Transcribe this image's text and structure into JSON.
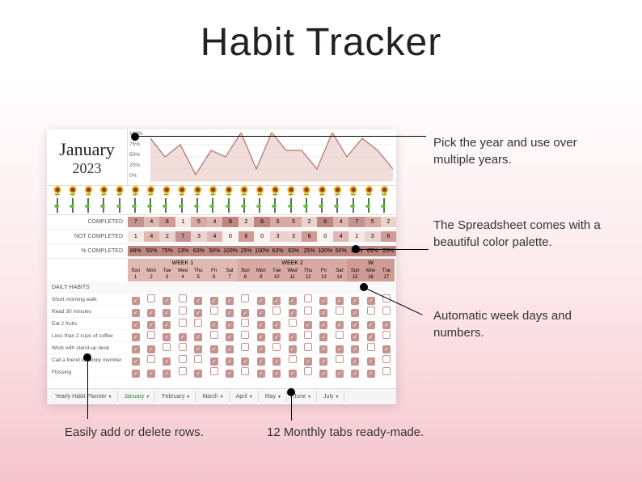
{
  "title": "Habit Tracker",
  "month": "January",
  "year": "2023",
  "chart_data": {
    "type": "area",
    "ylabel": "",
    "xlabel": "",
    "ylim": [
      0,
      100
    ],
    "yticks": [
      "100%",
      "75%",
      "50%",
      "25%",
      "0%"
    ],
    "values": [
      88,
      50,
      75,
      13,
      63,
      50,
      100,
      25,
      100,
      63,
      63,
      25,
      100,
      50,
      88,
      63,
      25
    ]
  },
  "summary": {
    "rows": [
      {
        "label": "COMPLETED",
        "values": [
          "7",
          "4",
          "6",
          "1",
          "5",
          "4",
          "8",
          "2",
          "8",
          "5",
          "5",
          "2",
          "8",
          "4",
          "7",
          "5",
          "2"
        ]
      },
      {
        "label": "NOT COMPLETED",
        "values": [
          "1",
          "4",
          "2",
          "7",
          "3",
          "4",
          "0",
          "6",
          "0",
          "3",
          "3",
          "6",
          "0",
          "4",
          "1",
          "3",
          "6"
        ]
      },
      {
        "label": "% COMPLETED",
        "values": [
          "88%",
          "50%",
          "75%",
          "13%",
          "63%",
          "50%",
          "100%",
          "25%",
          "100%",
          "63%",
          "63%",
          "25%",
          "100%",
          "50%",
          "88%",
          "63%",
          "25%"
        ]
      }
    ]
  },
  "weeks": [
    {
      "title": "WEEK 1",
      "days": [
        "Sun",
        "Mon",
        "Tue",
        "Wed",
        "Thu",
        "Fri",
        "Sat"
      ],
      "nums": [
        "1",
        "2",
        "3",
        "4",
        "5",
        "6",
        "7"
      ]
    },
    {
      "title": "WEEK 2",
      "days": [
        "Sun",
        "Mon",
        "Tue",
        "Wed",
        "Thu",
        "Fri",
        "Sat"
      ],
      "nums": [
        "8",
        "9",
        "10",
        "11",
        "12",
        "13",
        "14"
      ]
    },
    {
      "title": "W",
      "days": [
        "Sun",
        "Mon",
        "Tue"
      ],
      "nums": [
        "15",
        "16",
        "17"
      ]
    }
  ],
  "habits_header": "DAILY HABITS",
  "habits": [
    {
      "name": "Short morning walk",
      "checks": [
        1,
        0,
        1,
        0,
        1,
        1,
        1,
        0,
        1,
        1,
        1,
        0,
        1,
        1,
        1,
        1,
        0
      ]
    },
    {
      "name": "Read 30 minutes",
      "checks": [
        1,
        1,
        1,
        0,
        1,
        0,
        1,
        1,
        1,
        0,
        1,
        0,
        1,
        0,
        1,
        0,
        0
      ]
    },
    {
      "name": "Eat 2 fruits",
      "checks": [
        1,
        1,
        1,
        0,
        0,
        1,
        1,
        0,
        1,
        1,
        0,
        1,
        1,
        1,
        1,
        1,
        1
      ]
    },
    {
      "name": "Less than 2 cups of coffee",
      "checks": [
        1,
        0,
        1,
        1,
        1,
        0,
        1,
        0,
        1,
        1,
        1,
        0,
        1,
        0,
        1,
        1,
        0
      ]
    },
    {
      "name": "Work with stand-up desk",
      "checks": [
        1,
        1,
        0,
        0,
        1,
        1,
        1,
        0,
        1,
        0,
        1,
        0,
        1,
        1,
        1,
        0,
        1
      ]
    },
    {
      "name": "Call a friend or family member",
      "checks": [
        1,
        0,
        1,
        0,
        0,
        1,
        1,
        1,
        1,
        1,
        0,
        1,
        1,
        0,
        1,
        1,
        0
      ]
    },
    {
      "name": "Flossing",
      "checks": [
        1,
        1,
        1,
        0,
        1,
        0,
        1,
        0,
        1,
        1,
        1,
        0,
        1,
        1,
        1,
        1,
        0
      ]
    }
  ],
  "tabs": [
    {
      "label": "Yearly Habit Planner",
      "active": false
    },
    {
      "label": "January",
      "active": true
    },
    {
      "label": "February",
      "active": false
    },
    {
      "label": "March",
      "active": false
    },
    {
      "label": "April",
      "active": false
    },
    {
      "label": "May",
      "active": false
    },
    {
      "label": "June",
      "active": false
    },
    {
      "label": "July",
      "active": false
    }
  ],
  "callouts": {
    "c1": "Pick the year and use over multiple years.",
    "c2": "The Spreadsheet comes with a beautiful color palette.",
    "c3": "Automatic week days and numbers.",
    "c4": "Easily add or delete rows.",
    "c5": "12 Monthly tabs ready-made."
  },
  "colors": {
    "heat": [
      "#e8c8c3",
      "#d9aaa3",
      "#cf9b94",
      "#c4928f",
      "#bd8680",
      "#e8c8c3",
      "#f0ded9"
    ]
  }
}
